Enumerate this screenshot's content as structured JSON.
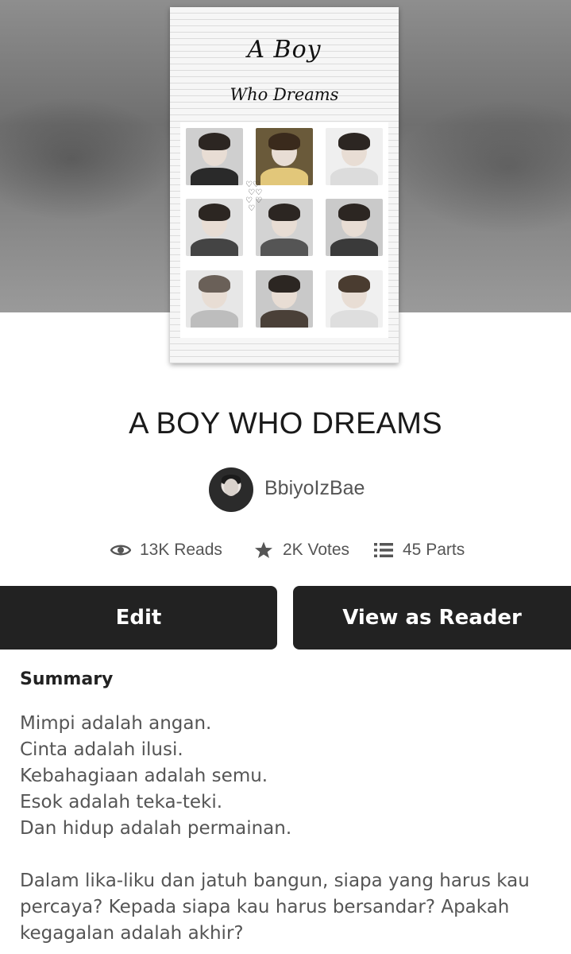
{
  "cover": {
    "title": "A Boy",
    "subtitle": "Who Dreams"
  },
  "story": {
    "title": "A BOY WHO DREAMS",
    "author": "BbiyoIzBae"
  },
  "stats": {
    "reads": "13K Reads",
    "votes": "2K Votes",
    "parts": "45 Parts"
  },
  "actions": {
    "edit_label": "Edit",
    "view_label": "View as Reader"
  },
  "summary": {
    "heading": "Summary",
    "lines": [
      "Mimpi adalah angan.",
      "Cinta adalah ilusi.",
      "Kebahagiaan adalah semu.",
      "Esok adalah teka-teki.",
      "Dan hidup adalah permainan."
    ],
    "paragraph": "Dalam lika-liku dan jatuh bangun, siapa yang harus kau percaya? Kepada siapa kau harus bersandar? Apakah kegagalan adalah akhir?"
  },
  "icons": {
    "reads": "eye-icon",
    "votes": "star-icon",
    "parts": "list-icon"
  },
  "colors": {
    "button_bg": "#222222",
    "button_text": "#ffffff",
    "stat_text": "#555555"
  }
}
